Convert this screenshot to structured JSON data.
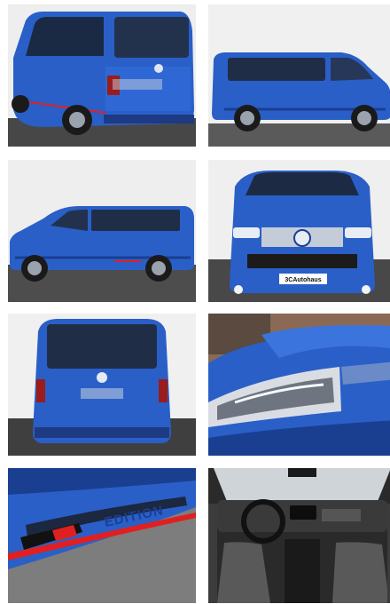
{
  "gallery": {
    "dealer_logo_text": "3CAutohaus",
    "decal_text": "EDITION",
    "colors": {
      "paint": "#2a5fc8",
      "paint_dark": "#1a3f91",
      "accent_red": "#e02020"
    },
    "photos": [
      {
        "view": "rear-three-quarter"
      },
      {
        "view": "side-right"
      },
      {
        "view": "side-left"
      },
      {
        "view": "front"
      },
      {
        "view": "rear"
      },
      {
        "view": "headlight-detail"
      },
      {
        "view": "side-decal-detail"
      },
      {
        "view": "interior-dashboard"
      }
    ]
  }
}
